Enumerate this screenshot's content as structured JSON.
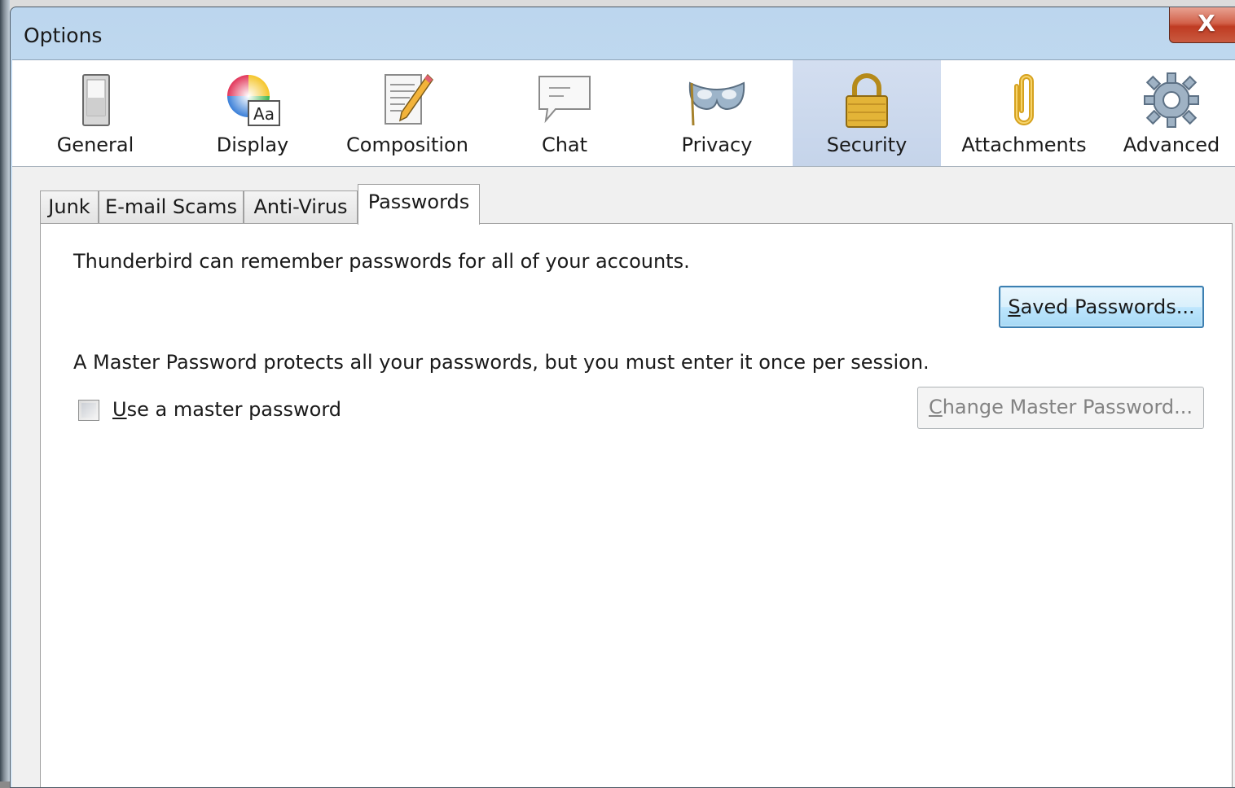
{
  "window": {
    "title": "Options",
    "close_glyph": "X"
  },
  "panes": [
    {
      "label": "General",
      "icon": "general-switch-icon",
      "selected": false
    },
    {
      "label": "Display",
      "icon": "display-color-wheel-icon",
      "icon_text": "Aa",
      "selected": false
    },
    {
      "label": "Composition",
      "icon": "composition-pencil-icon",
      "selected": false
    },
    {
      "label": "Chat",
      "icon": "chat-bubble-icon",
      "selected": false
    },
    {
      "label": "Privacy",
      "icon": "privacy-mask-icon",
      "selected": false
    },
    {
      "label": "Security",
      "icon": "security-padlock-icon",
      "selected": true
    },
    {
      "label": "Attachments",
      "icon": "attachments-paperclip-icon",
      "selected": false
    },
    {
      "label": "Advanced",
      "icon": "advanced-gear-icon",
      "selected": false
    }
  ],
  "tabs": [
    {
      "label": "Junk",
      "active": false
    },
    {
      "label": "E-mail Scams",
      "active": false
    },
    {
      "label": "Anti-Virus",
      "active": false
    },
    {
      "label": "Passwords",
      "active": true
    }
  ],
  "passwords": {
    "remember_text": "Thunderbird can remember passwords for all of your accounts.",
    "saved_button": {
      "accesskey": "S",
      "rest": "aved Passwords..."
    },
    "master_text": "A Master Password protects all your passwords, but you must enter it once per session.",
    "master_checkbox": {
      "accesskey": "U",
      "rest": "se a master password",
      "checked": false
    },
    "change_button": {
      "accesskey": "C",
      "rest": "hange Master Password...",
      "disabled": true
    }
  },
  "colors": {
    "selected_pane": "#c9d7ec",
    "default_button_border": "#3c7fb1",
    "close_button": "#c95a40"
  }
}
